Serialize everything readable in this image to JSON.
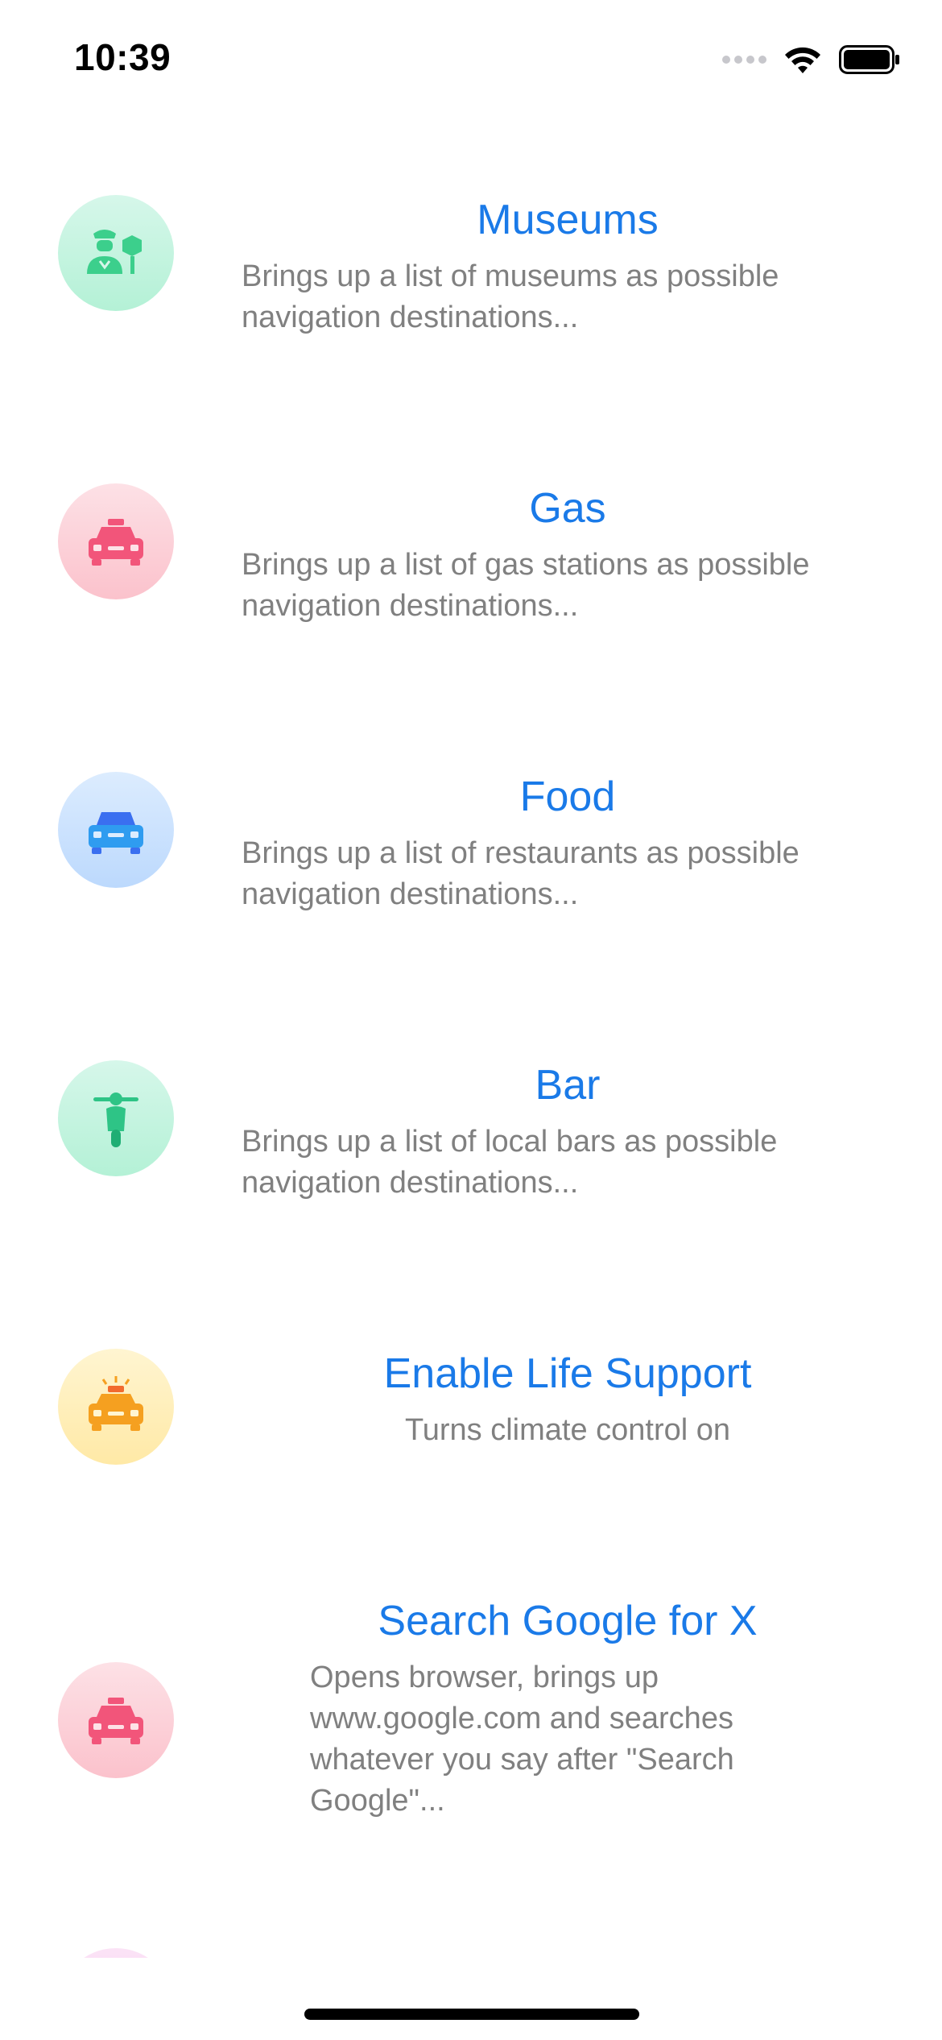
{
  "status_bar": {
    "time": "10:39"
  },
  "list": {
    "items": [
      {
        "title": "Museums",
        "subtitle": "Brings up a list of museums as possible navigation destinations...",
        "icon": "police-officer-icon",
        "gradient": [
          "#d6f7ea",
          "#b4f1d6"
        ],
        "icon_color": "#3ccf8c"
      },
      {
        "title": "Gas",
        "subtitle": "Brings up a list of gas stations as possible navigation destinations...",
        "icon": "taxi-icon",
        "gradient": [
          "#fde1e6",
          "#fbc2cc"
        ],
        "icon_color": "#f2557a"
      },
      {
        "title": "Food",
        "subtitle": "Brings up a list of restaurants as possible navigation destinations...",
        "icon": "car-icon",
        "gradient": [
          "#dcecfe",
          "#bcd9fd"
        ],
        "icon_color": "#3a6ff0"
      },
      {
        "title": "Bar",
        "subtitle": "Brings up a list of local bars as possible navigation destinations...",
        "icon": "scooter-icon",
        "gradient": [
          "#d6f7ea",
          "#b4f1d6"
        ],
        "icon_color": "#2ec486"
      },
      {
        "title": "Enable Life Support",
        "subtitle": "Turns climate control on",
        "icon": "police-car-icon",
        "gradient": [
          "#fff5d1",
          "#ffe9a6"
        ],
        "icon_color": "#f5a020"
      },
      {
        "title": "Search Google for X",
        "subtitle": "Opens browser, brings up www.google.com and searches whatever you say after \"Search Google\"...",
        "icon": "taxi-icon",
        "gradient": [
          "#fde1e6",
          "#fbc2cc"
        ],
        "icon_color": "#f2557a"
      }
    ]
  }
}
